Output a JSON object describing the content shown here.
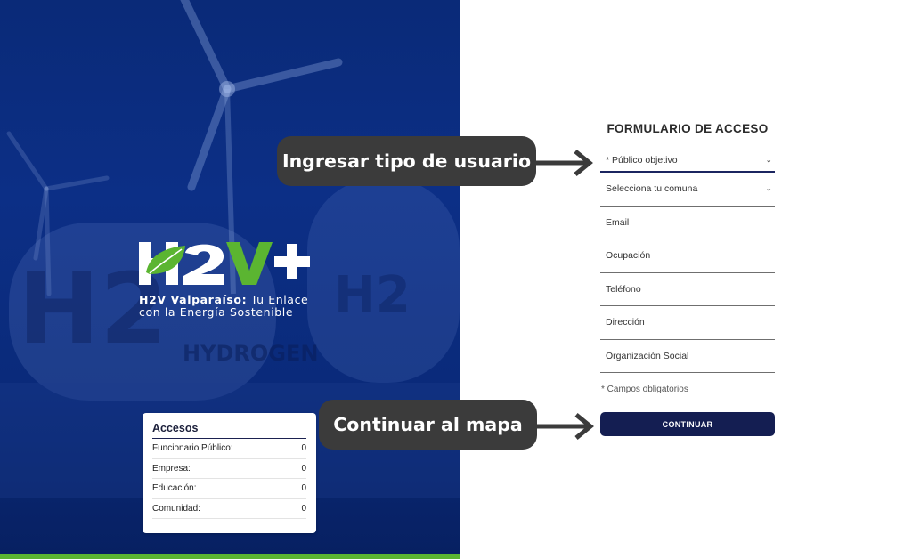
{
  "hero": {
    "logo": {
      "brand": "H2V+",
      "tagline_bold": "H2V Valparaíso:",
      "tagline_rest": " Tu Enlace",
      "tagline_line2": "con la Energía Sostenible"
    },
    "background_words": {
      "h2_big": "H2",
      "h2_small": "H2",
      "hydrogen": "HYDROGEN"
    },
    "colors": {
      "panel": "#0c2f86",
      "leaf": "#5bb531",
      "stripe": "#5bb531"
    }
  },
  "accesos": {
    "title": "Accesos",
    "rows": [
      {
        "label": "Funcionario Público:",
        "value": "0"
      },
      {
        "label": "Empresa:",
        "value": "0"
      },
      {
        "label": "Educación:",
        "value": "0"
      },
      {
        "label": "Comunidad:",
        "value": "0"
      }
    ]
  },
  "form": {
    "title": "FORMULARIO DE ACCESO",
    "user_type": {
      "value": "* Público objetivo",
      "icon": "chevron-down-icon"
    },
    "comuna": {
      "value": "Selecciona tu comuna",
      "icon": "chevron-down-icon"
    },
    "email": {
      "placeholder": "Email"
    },
    "ocupacion": {
      "placeholder": "Ocupación"
    },
    "telefono": {
      "placeholder": "Teléfono"
    },
    "direccion": {
      "placeholder": "Dirección"
    },
    "organizacion": {
      "placeholder": "Organización Social"
    },
    "required_note": "* Campos obligatorios",
    "submit_label": "CONTINUAR",
    "colors": {
      "button": "#141e52",
      "active_underline": "#1b2560"
    }
  },
  "annotations": {
    "callout_1": "Ingresar tipo de usuario",
    "callout_2": "Continuar al mapa",
    "colors": {
      "bubble": "#3b3b3b",
      "arrow": "#3b3b3b"
    }
  }
}
